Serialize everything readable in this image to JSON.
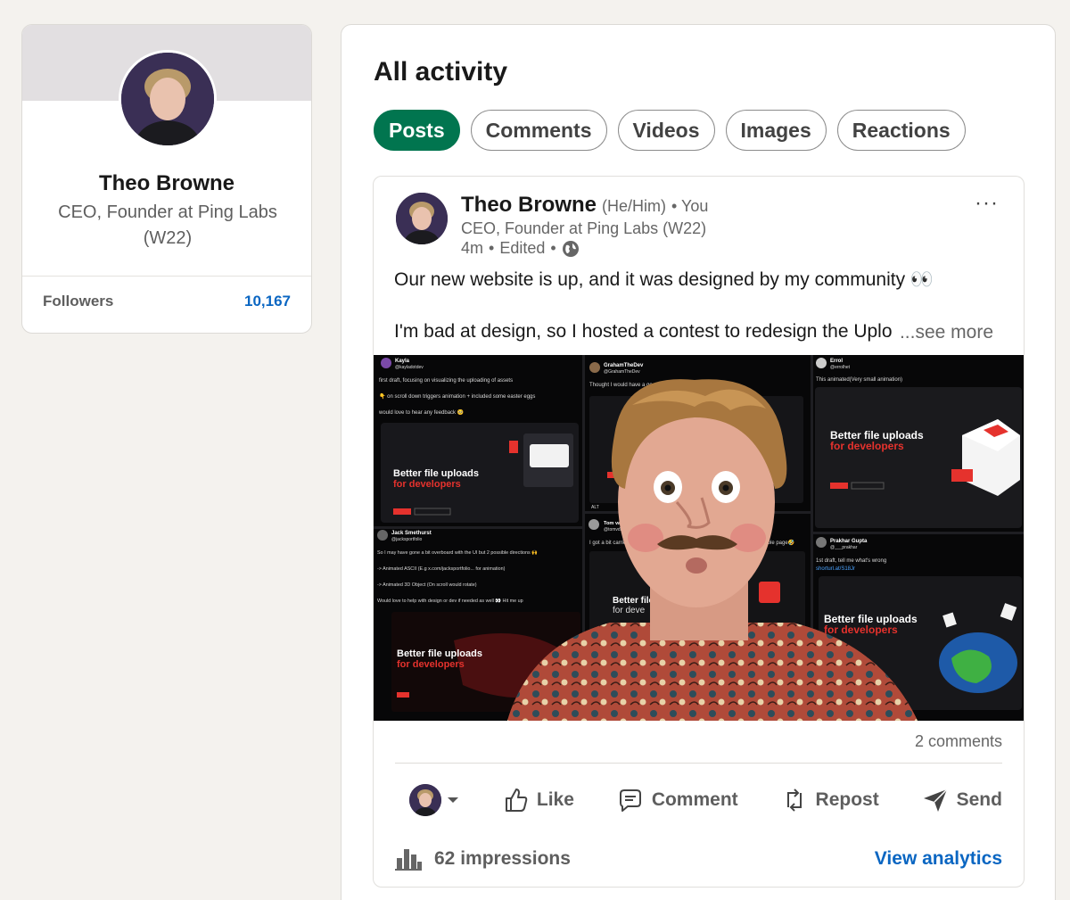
{
  "profile": {
    "name": "Theo Browne",
    "headline": "CEO, Founder at Ping Labs (W22)",
    "followers_label": "Followers",
    "followers_count": "10,167"
  },
  "activity": {
    "title": "All activity",
    "filters": [
      {
        "label": "Posts",
        "active": true
      },
      {
        "label": "Comments",
        "active": false
      },
      {
        "label": "Videos",
        "active": false
      },
      {
        "label": "Images",
        "active": false
      },
      {
        "label": "Reactions",
        "active": false
      }
    ]
  },
  "post": {
    "author_name": "Theo Browne",
    "pronouns": "(He/Him)",
    "you_label": "• You",
    "headline": "CEO, Founder at Ping Labs (W22)",
    "time": "4m",
    "edited": "Edited",
    "more_icon": "···",
    "text_line1": "Our new website is up, and it was designed by my community 👀",
    "text_line2": "I'm bad at design, so I hosted a contest to redesign the Uplo",
    "see_more": "...see more",
    "collage": {
      "tiles": [
        {
          "user": "Kayla",
          "handle": "@kayladotdev",
          "line1": "first draft, focusing on visualizing the uploading of assets",
          "line2": "👇 on scroll down triggers animation + included some easter eggs",
          "line3": "would love to hear any feedback 🥺",
          "title": "Better file uploads",
          "sub": "for developers"
        },
        {
          "user": "GrahamTheDev",
          "handle": "@GrahamTheDev",
          "line1": "Thought I would have a go"
        },
        {
          "user": "Errol",
          "handle": "@errolhet",
          "line1": "This animated(Very small animation)",
          "title": "Better file uploads",
          "sub": "for developers"
        },
        {
          "user": "Jack Smethurst",
          "handle": "@jacksportfolio",
          "line1": "So I may have gone a bit overboard with the UI but 2 possible directions 🙌",
          "line2": "-> Animated ASCII (E.g x.com/jacksportfolio... for animation)",
          "line3": "-> Animated 3D Object (On scroll would rotate)",
          "line4": "Would love to help with design or dev if needed as well 👀 Hit me up",
          "title": "Better file uploads",
          "sub": "for developers"
        },
        {
          "user": "Tom van",
          "handle": "@tomvdb",
          "line1": "I got a bit carried",
          "line2": "whole page🤣",
          "title": "Better file",
          "sub": "for deve"
        },
        {
          "user": "Prakhar Gupta",
          "handle": "@___prakhar",
          "line1": "1st draft, tell me what's wrong",
          "line2": "shorturl.at/S18Jr",
          "title": "Better file uploads",
          "sub": "for developers"
        }
      ],
      "alt_badge": "ALT"
    },
    "comments": "2 comments",
    "actions": {
      "like": "Like",
      "comment": "Comment",
      "repost": "Repost",
      "send": "Send"
    },
    "impressions": "62 impressions",
    "view_analytics": "View analytics"
  }
}
